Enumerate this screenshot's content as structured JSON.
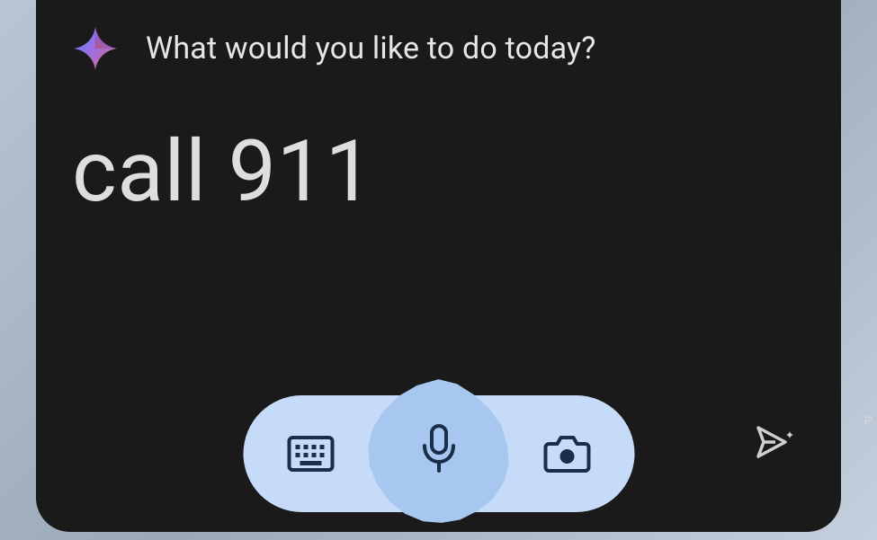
{
  "assistant": {
    "prompt": "What would you like to do today?",
    "transcript": "call 911"
  },
  "icons": {
    "sparkle": "sparkle-icon",
    "keyboard": "keyboard-icon",
    "mic": "mic-icon",
    "camera": "camera-icon",
    "send": "send-icon"
  },
  "side_label": "P"
}
